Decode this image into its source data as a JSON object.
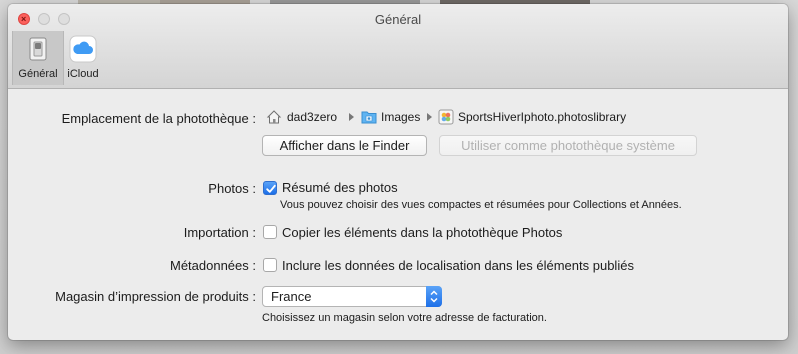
{
  "window": {
    "title": "Général"
  },
  "toolbar": {
    "tabs": [
      {
        "label": "Général",
        "icon": "general-switch-icon",
        "selected": true
      },
      {
        "label": "iCloud",
        "icon": "icloud-icon",
        "selected": false
      }
    ]
  },
  "library": {
    "label": "Emplacement de la photothèque :",
    "path": [
      {
        "name": "dad3zero",
        "icon": "home-folder-icon"
      },
      {
        "name": "Images",
        "icon": "pictures-folder-icon"
      },
      {
        "name": "SportsHiverIphoto.photoslibrary",
        "icon": "photos-library-icon"
      }
    ],
    "show_in_finder": "Afficher dans le Finder",
    "use_as_system_library": "Utiliser comme photothèque système"
  },
  "photos": {
    "label": "Photos :",
    "checkbox_label": "Résumé des photos",
    "checked": true,
    "note": "Vous pouvez choisir des vues compactes et résumées pour Collections et Années."
  },
  "import": {
    "label": "Importation :",
    "checkbox_label": "Copier les éléments dans la photothèque Photos",
    "checked": false
  },
  "metadata": {
    "label": "Métadonnées :",
    "checkbox_label": "Inclure les données de localisation dans les éléments publiés",
    "checked": false
  },
  "store": {
    "label": "Magasin d’impression de produits :",
    "selected": "France",
    "note": "Choisissez un magasin selon votre adresse de facturation."
  },
  "colors": {
    "accent": "#1d6fe8",
    "close_button": "#fc605c",
    "window_bg": "#ececec"
  }
}
